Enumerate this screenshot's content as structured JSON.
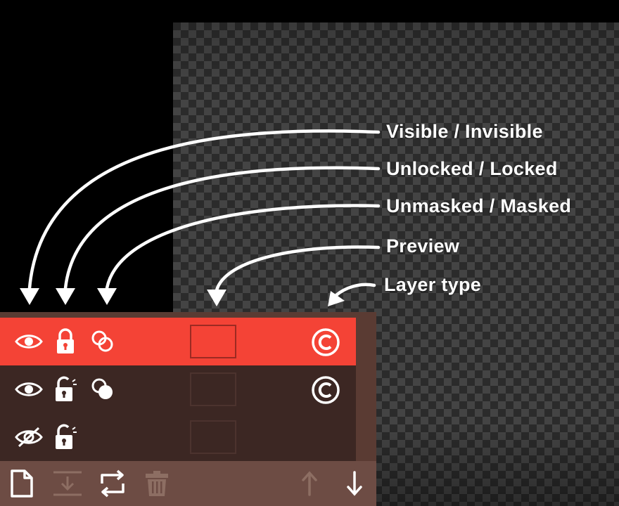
{
  "callouts": {
    "visibility": "Visible / Invisible",
    "lock": "Unlocked / Locked",
    "mask": "Unmasked / Masked",
    "preview": "Preview",
    "layer_type": "Layer type"
  },
  "layers": [
    {
      "visible": true,
      "locked": true,
      "masked": false,
      "type_icon": "copyright-icon",
      "selected": true
    },
    {
      "visible": true,
      "locked": false,
      "masked": true,
      "type_icon": "copyright-icon",
      "selected": false
    },
    {
      "visible": false,
      "locked": false,
      "masked": null,
      "type_icon": null,
      "selected": false
    }
  ],
  "toolbar": {
    "buttons": [
      "new-layer-icon",
      "merge-down-icon",
      "swap-icon",
      "trash-icon",
      "arrow-up-icon",
      "arrow-down-icon"
    ]
  },
  "colors": {
    "selected_row": "#f44336",
    "row": "#3c2723",
    "toolbar": "#6d4c44",
    "icon_white": "#ffffff",
    "icon_disabled": "#8d6e63"
  }
}
